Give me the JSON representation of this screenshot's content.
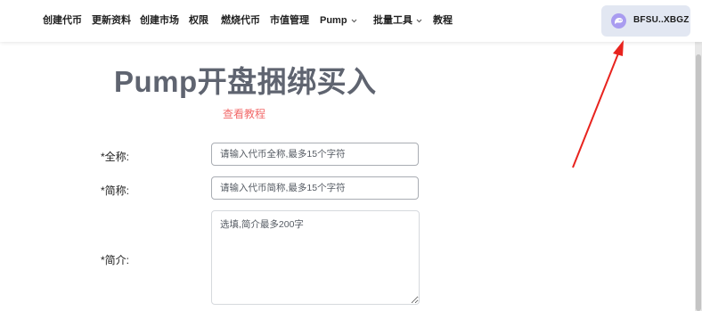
{
  "nav": {
    "items": [
      {
        "label": "创建代币"
      },
      {
        "label": "更新资料"
      },
      {
        "label": "创建市场"
      },
      {
        "label": "权限"
      },
      {
        "label": "燃烧代币"
      },
      {
        "label": "市值管理"
      },
      {
        "label": "Pump"
      },
      {
        "label": "批量工具"
      },
      {
        "label": "教程"
      }
    ]
  },
  "wallet": {
    "address": "BFSU..XBGZ",
    "icon": "wallet-avatar-icon",
    "color": "#a99cf0"
  },
  "page": {
    "title": "Pump开盘捆绑买入",
    "tutorial_link": "查看教程"
  },
  "form": {
    "full_name": {
      "label": "*全称:",
      "placeholder": "请输入代币全称,最多15个字符",
      "value": ""
    },
    "short_name": {
      "label": "*简称:",
      "placeholder": "请输入代币简称,最多15个字符",
      "value": ""
    },
    "intro": {
      "label": "*简介:",
      "placeholder": "选填,简介最多200字",
      "value": ""
    }
  },
  "annotation": {
    "color": "#e8231e"
  },
  "colors": {
    "link": "#f26a6a",
    "title": "#5f6470",
    "wallet_bg": "#e2e7f2"
  }
}
